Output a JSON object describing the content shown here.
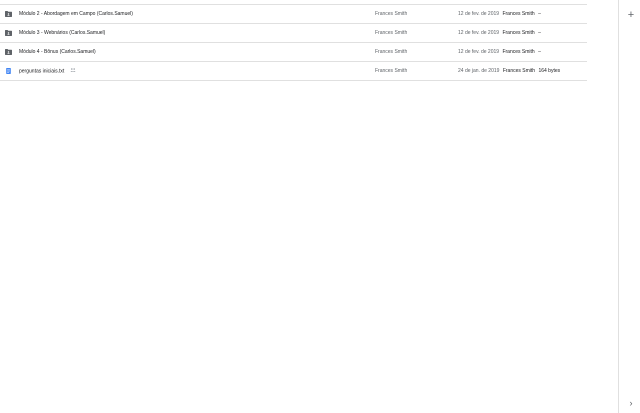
{
  "files": [
    {
      "name": "Módulo 2 - Abordagem em Campo (Carlos.Samuel)",
      "type": "shared-folder",
      "owner": "Frances Smith",
      "modified_date": "12 de fev. de 2019",
      "modified_by": "Frances Smith",
      "size": "–"
    },
    {
      "name": "Módulo 3 - Webnários (Carlos.Samuel)",
      "type": "shared-folder",
      "owner": "Frances Smith",
      "modified_date": "12 de fev. de 2019",
      "modified_by": "Frances Smith",
      "size": "–"
    },
    {
      "name": "Módulo 4 - Bônus (Carlos.Samuel)",
      "type": "shared-folder",
      "owner": "Frances Smith",
      "modified_date": "12 de fev. de 2019",
      "modified_by": "Frances Smith",
      "size": "–"
    },
    {
      "name": "perguntas iniciais.txt",
      "type": "text-document",
      "shared": true,
      "owner": "Frances Smith",
      "modified_date": "24 de jan. de 2019",
      "modified_by": "Frances Smith",
      "size": "164 bytes"
    }
  ],
  "side_panel": {
    "add_symbol": "+",
    "expand_symbol": "›"
  },
  "colors": {
    "folder_icon": "#5f6368",
    "doc_icon": "#4285f4",
    "divider": "#e0e0e0"
  }
}
